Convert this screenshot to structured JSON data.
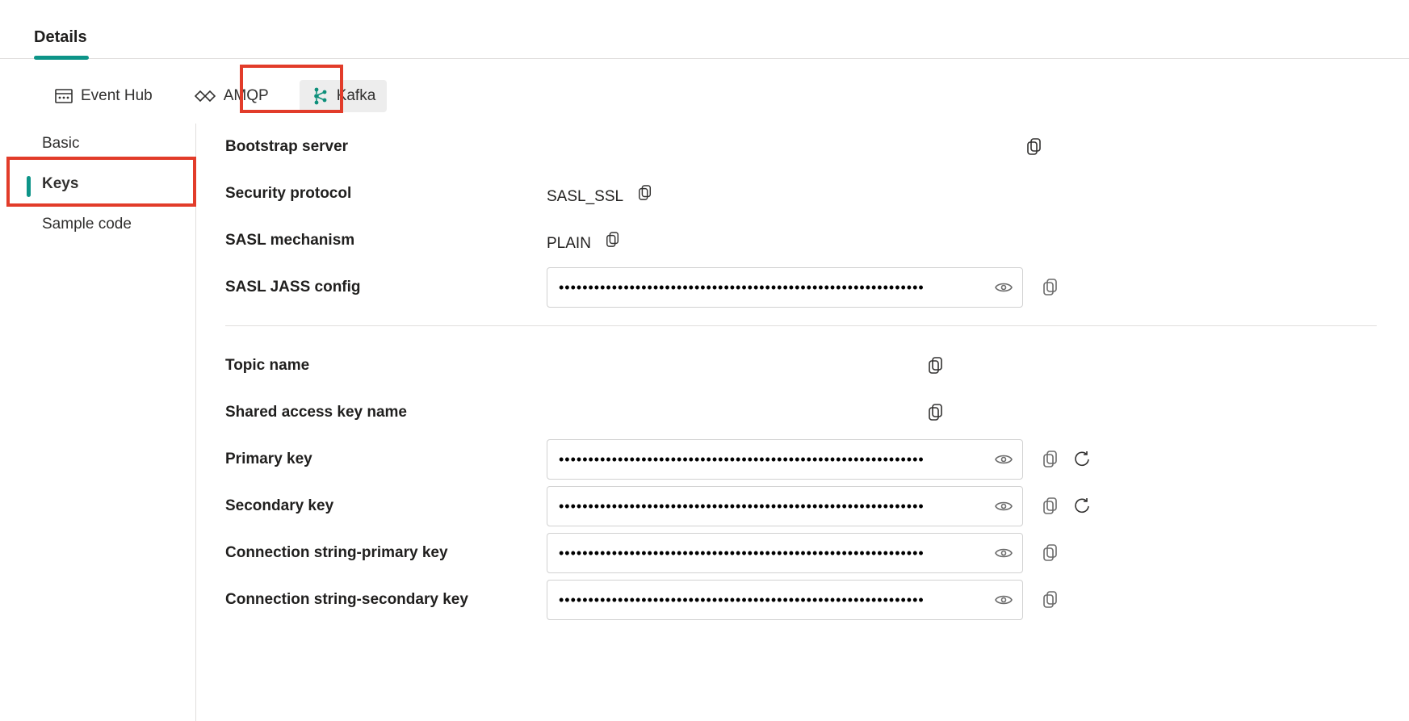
{
  "top_tabs": {
    "details": "Details"
  },
  "proto_tabs": {
    "eventhub": "Event Hub",
    "amqp": "AMQP",
    "kafka": "Kafka"
  },
  "side_nav": {
    "basic": "Basic",
    "keys": "Keys",
    "sample_code": "Sample code"
  },
  "fields": {
    "bootstrap_server": {
      "label": "Bootstrap server",
      "value": ""
    },
    "security_protocol": {
      "label": "Security protocol",
      "value": "SASL_SSL"
    },
    "sasl_mechanism": {
      "label": "SASL mechanism",
      "value": "PLAIN"
    },
    "sasl_jass_config": {
      "label": "SASL JASS config"
    },
    "topic_name": {
      "label": "Topic name",
      "value": ""
    },
    "shared_access_key_name": {
      "label": "Shared access key name",
      "value": ""
    },
    "primary_key": {
      "label": "Primary key"
    },
    "secondary_key": {
      "label": "Secondary key"
    },
    "conn_primary": {
      "label": "Connection string-primary key"
    },
    "conn_secondary": {
      "label": "Connection string-secondary key"
    }
  }
}
